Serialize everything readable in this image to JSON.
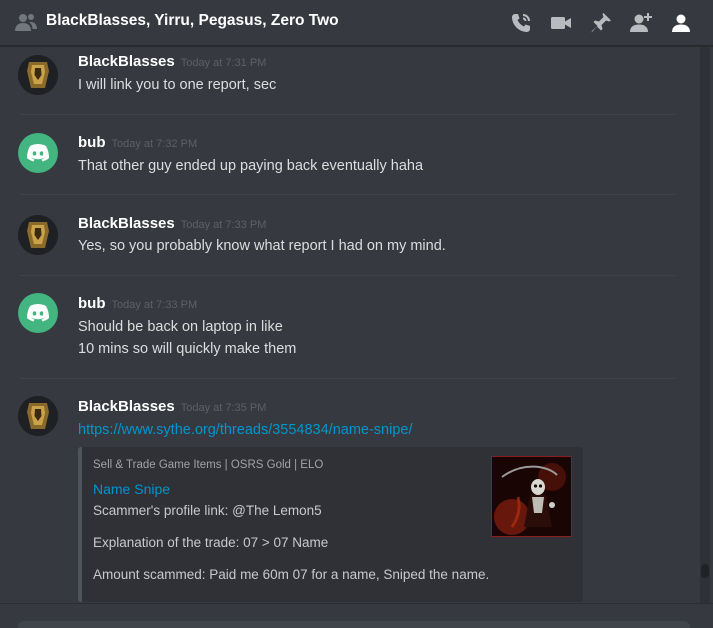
{
  "header": {
    "title": "BlackBlasses, Yirru, Pegasus, Zero Two",
    "icons": [
      "people-icon",
      "call-icon",
      "video-icon",
      "pin-icon",
      "add-member-icon",
      "member-list-icon"
    ]
  },
  "colors": {
    "background": "#36393f",
    "link": "#0096cf",
    "discord_green": "#43b581",
    "embed_bg": "#2f3136"
  },
  "messages": [
    {
      "author": "BlackBlasses",
      "time": "Today at 7:31 PM",
      "lines": [
        "I will link you to one report, sec"
      ]
    },
    {
      "author": "bub",
      "time": "Today at 7:32 PM",
      "lines": [
        "That other guy ended up paying back eventually haha"
      ]
    },
    {
      "author": "BlackBlasses",
      "time": "Today at 7:33 PM",
      "lines": [
        "Yes, so you probably know what report I had on my mind."
      ]
    },
    {
      "author": "bub",
      "time": "Today at 7:33 PM",
      "lines": [
        "Should be back on laptop in like",
        "10 mins so will quickly make them"
      ]
    },
    {
      "author": "BlackBlasses",
      "time": "Today at 7:35 PM",
      "link": "https://www.sythe.org/threads/3554834/name-snipe/",
      "embed": {
        "provider": "Sell & Trade Game Items | OSRS Gold | ELO",
        "title": "Name Snipe",
        "lines": [
          "Scammer's profile link: @The Lemon5",
          "Explanation of the trade: 07 > 07 Name",
          "Amount scammed: Paid me 60m 07 for a name, Sniped the name."
        ]
      }
    }
  ]
}
